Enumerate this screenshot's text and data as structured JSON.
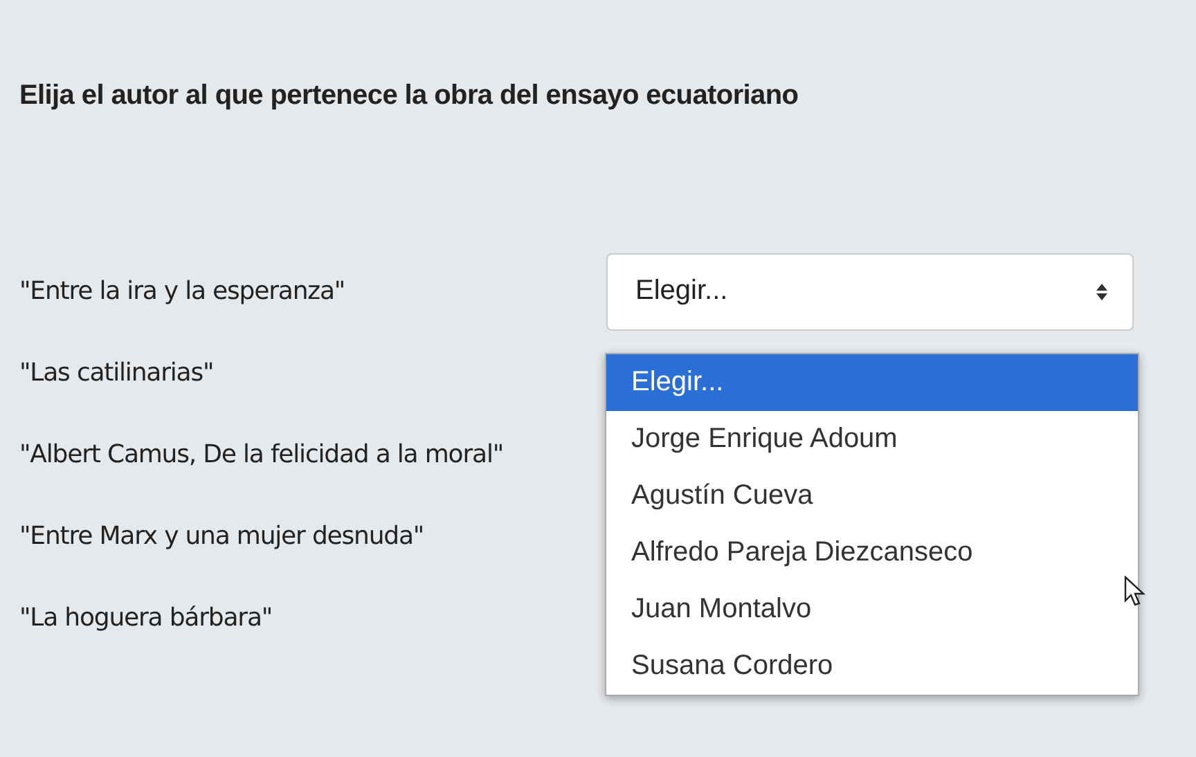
{
  "question": "Elija el autor al que pertenece la obra del ensayo ecuatoriano",
  "prompts": [
    "\"Entre la ira y la esperanza\"",
    "\"Las catilinarias\"",
    "\"Albert Camus, De la felicidad a la moral\"",
    "\"Entre Marx y una mujer desnuda\"",
    "\"La hoguera bárbara\""
  ],
  "select": {
    "value": "Elegir..."
  },
  "options": [
    {
      "label": "Elegir...",
      "selected": true
    },
    {
      "label": "Jorge Enrique Adoum",
      "selected": false
    },
    {
      "label": "Agustín Cueva",
      "selected": false
    },
    {
      "label": "Alfredo Pareja Diezcanseco",
      "selected": false
    },
    {
      "label": "Juan Montalvo",
      "selected": false
    },
    {
      "label": "Susana Cordero",
      "selected": false
    }
  ]
}
